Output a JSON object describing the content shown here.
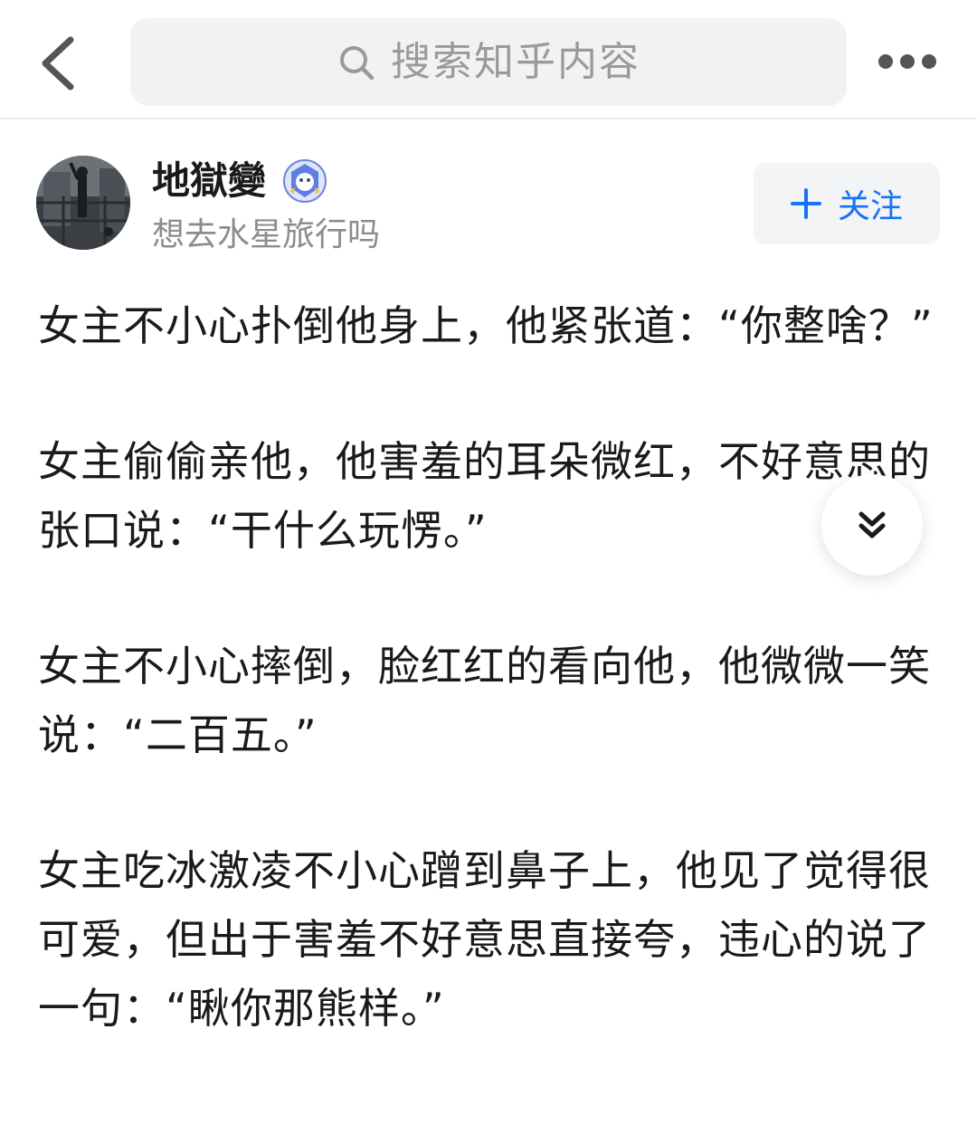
{
  "header": {
    "search_placeholder": "搜索知乎内容",
    "icons": {
      "back": "chevron-left-icon",
      "search": "search-icon",
      "more": "more-horizontal-icon"
    }
  },
  "author": {
    "name": "地獄變",
    "bio": "想去水星旅行吗",
    "follow_label": "关注",
    "badge": "verified-badge-icon"
  },
  "article": {
    "paragraphs": [
      "女主不小心扑倒他身上，他紧张道：“你整啥？”",
      "女主偷偷亲他，他害羞的耳朵微红，不好意思的张口说：“干什么玩愣。”",
      "女主不小心摔倒，脸红红的看向他，他微微一笑说：“二百五。”",
      "女主吃冰激凌不小心蹭到鼻子上，他见了觉得很可爱，但出于害羞不好意思直接夸，违心的说了一句：“瞅你那熊样。”"
    ]
  },
  "floating_button": {
    "icon": "chevrons-down-icon"
  },
  "colors": {
    "accent": "#1772f6",
    "text": "#1a1a1a",
    "muted": "#8c8c8c",
    "search_bg": "#f2f2f2"
  }
}
